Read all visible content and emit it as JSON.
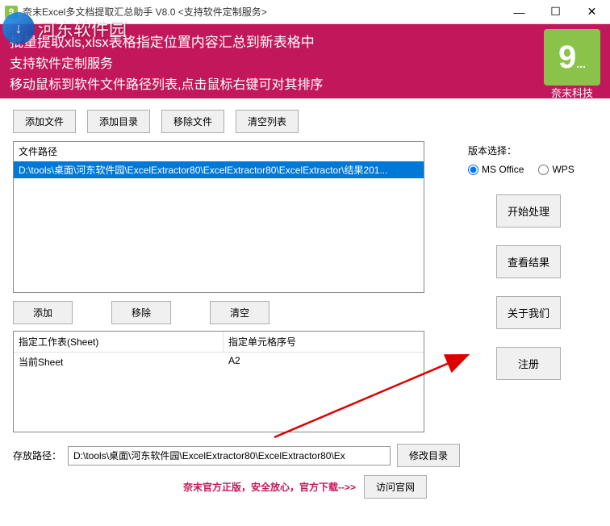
{
  "titlebar": {
    "title": "奈末Excel多文档提取汇总助手  V8.0  <支持软件定制服务>"
  },
  "watermark": {
    "text": "河东软件园"
  },
  "banner": {
    "line1": "批量提取xls,xlsx表格指定位置内容汇总到新表格中",
    "line2": "支持软件定制服务",
    "line3": "移动鼠标到软件文件路径列表,点击鼠标右键可对其排序",
    "logo_text": "奈末科技"
  },
  "toolbar": {
    "add_file": "添加文件",
    "add_dir": "添加目录",
    "remove_file": "移除文件",
    "clear_list": "清空列表"
  },
  "file_list": {
    "header": "文件路径",
    "items": [
      "D:\\tools\\桌面\\河东软件园\\ExcelExtractor80\\ExcelExtractor80\\ExcelExtractor\\结果201..."
    ]
  },
  "version": {
    "label": "版本选择：",
    "ms_office": "MS Office",
    "wps": "WPS",
    "selected": "ms"
  },
  "side_buttons": {
    "start": "开始处理",
    "view_result": "查看结果",
    "about": "关于我们",
    "register": "注册"
  },
  "sheet_toolbar": {
    "add": "添加",
    "remove": "移除",
    "clear": "清空"
  },
  "sheet_table": {
    "col1_header": "指定工作表(Sheet)",
    "col2_header": "指定单元格序号",
    "rows": [
      {
        "sheet": "当前Sheet",
        "cell": "A2"
      }
    ]
  },
  "save": {
    "label": "存放路径：",
    "path": "D:\\tools\\桌面\\河东软件园\\ExcelExtractor80\\ExcelExtractor80\\Ex",
    "modify_btn": "修改目录"
  },
  "footer": {
    "text": "奈末官方正版，安全放心，官方下载-->>",
    "visit_btn": "访问官网"
  }
}
